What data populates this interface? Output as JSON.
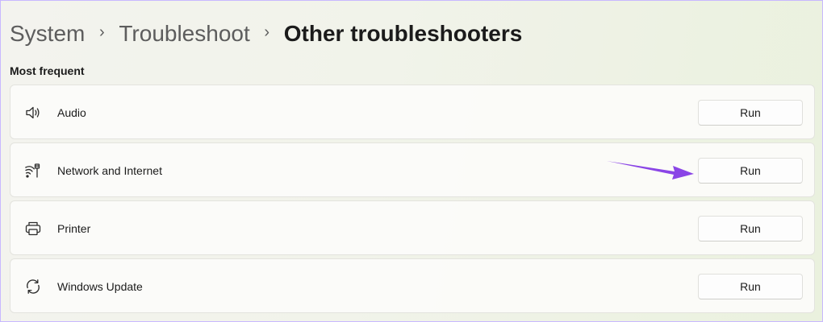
{
  "breadcrumb": {
    "items": [
      "System",
      "Troubleshoot"
    ],
    "separator": "›",
    "current": "Other troubleshooters"
  },
  "section": {
    "title": "Most frequent"
  },
  "troubleshooters": [
    {
      "label": "Audio",
      "icon": "speaker-icon",
      "button": "Run"
    },
    {
      "label": "Network and Internet",
      "icon": "wifi-ethernet-icon",
      "button": "Run"
    },
    {
      "label": "Printer",
      "icon": "printer-icon",
      "button": "Run"
    },
    {
      "label": "Windows Update",
      "icon": "sync-icon",
      "button": "Run"
    }
  ],
  "annotation": {
    "arrow_color": "#8a45e6",
    "points_to": "Network and Internet Run button"
  },
  "colors": {
    "frame_border": "#c8b8ff",
    "text_primary": "#1b1b1b",
    "text_secondary": "#5d5d5d"
  }
}
